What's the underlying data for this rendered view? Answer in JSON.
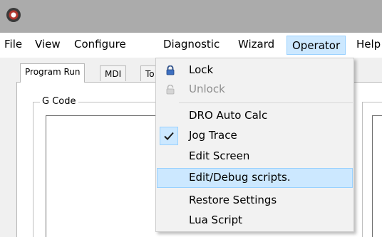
{
  "menubar": {
    "items": [
      {
        "label": "File"
      },
      {
        "label": "View"
      },
      {
        "label": "Configure"
      },
      {
        "label": "Diagnostic"
      },
      {
        "label": "Wizard"
      },
      {
        "label": "Operator"
      },
      {
        "label": "Help"
      }
    ]
  },
  "tabs": [
    {
      "label": "Program Run"
    },
    {
      "label": "MDI"
    },
    {
      "label": "To"
    }
  ],
  "gcode": {
    "label": "G Code"
  },
  "operator_menu": {
    "items": [
      {
        "label": "Lock",
        "icon": "lock-icon",
        "enabled": true
      },
      {
        "label": "Unlock",
        "icon": "unlock-icon",
        "enabled": false
      },
      {
        "label": "DRO Auto Calc",
        "enabled": true
      },
      {
        "label": "Jog Trace",
        "checked": true,
        "enabled": true
      },
      {
        "label": "Edit Screen",
        "enabled": true
      },
      {
        "label": "Edit/Debug scripts.",
        "highlighted": true,
        "enabled": true
      },
      {
        "label": "Restore Settings",
        "enabled": true
      },
      {
        "label": "Lua Script",
        "enabled": true
      }
    ]
  },
  "colors": {
    "highlight": "#cce8ff",
    "highlight_border": "#99d1ff",
    "titlebar": "#ababab"
  }
}
